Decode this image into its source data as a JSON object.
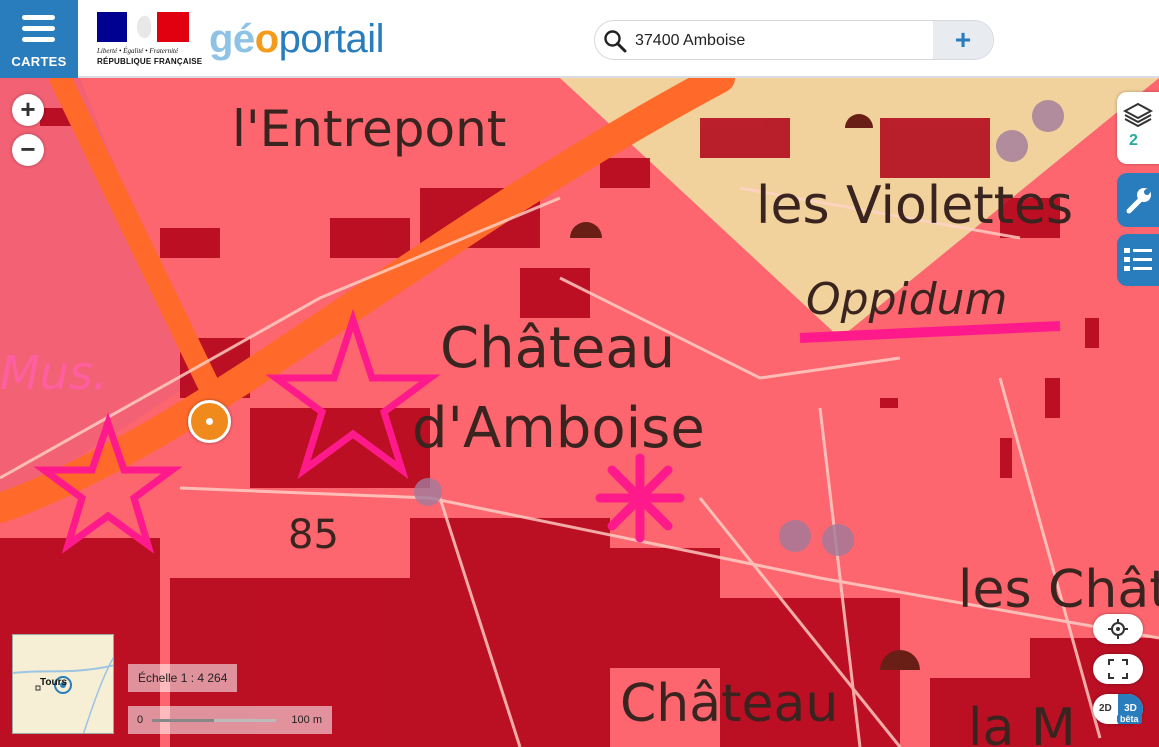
{
  "header": {
    "menu_label": "CARTES",
    "motto": "Liberté • Égalité • Fraternité",
    "republic": "RÉPUBLIQUE FRANÇAISE",
    "brand_part1": "gé",
    "brand_part2": "o",
    "brand_part3": "portail"
  },
  "search": {
    "value": "37400 Amboise",
    "add_label": "+"
  },
  "map": {
    "labels": {
      "entrepont": "l'Entrepont",
      "violettes": "les Violettes",
      "oppidum": "Oppidum",
      "chateau": "Château",
      "amboise": "d'Amboise",
      "mus": "Mus.",
      "chateau_bottom": "Château",
      "les_chat": "les Chât",
      "la_m": "la M",
      "road_number": "85"
    },
    "colors": {
      "overlay": "#ff4b5c",
      "marker": "#f08a1c",
      "accent": "#2a7dbd"
    }
  },
  "controls": {
    "zoom_in": "+",
    "zoom_out": "−",
    "layers_count": "2",
    "mode_2d": "2D",
    "mode_3d": "3D",
    "beta_label": "bêta"
  },
  "overview": {
    "label": "Tours"
  },
  "scale": {
    "ratio_text": "Échelle 1 : 4 264",
    "start": "0",
    "end": "100 m"
  }
}
